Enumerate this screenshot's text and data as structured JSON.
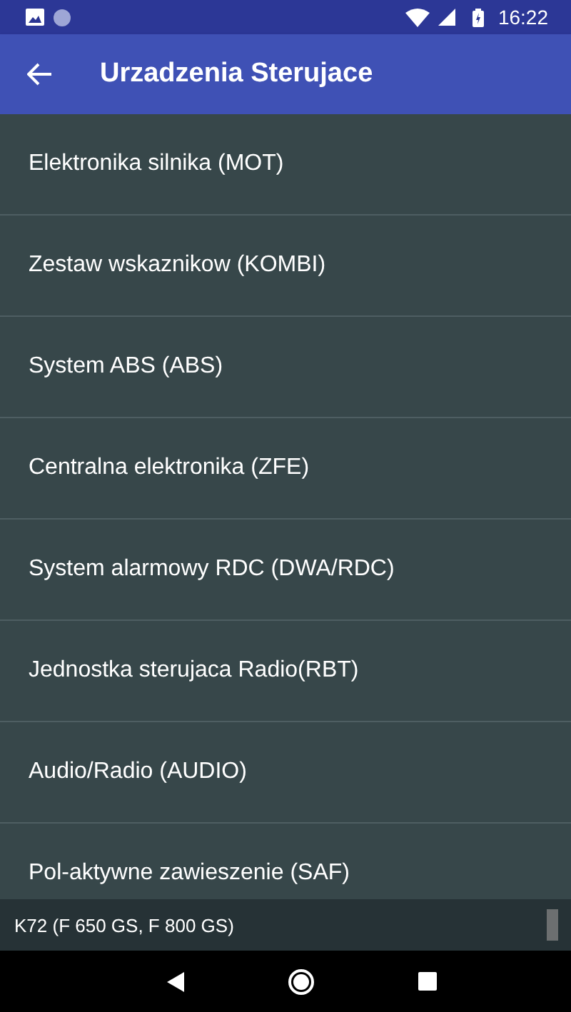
{
  "status_bar": {
    "time": "16:22"
  },
  "app_bar": {
    "title": "Urzadzenia Sterujace"
  },
  "items": [
    {
      "label": "Elektronika silnika (MOT)"
    },
    {
      "label": "Zestaw wskaznikow (KOMBI)"
    },
    {
      "label": "System ABS (ABS)"
    },
    {
      "label": "Centralna elektronika (ZFE)"
    },
    {
      "label": "System alarmowy RDC (DWA/RDC)"
    },
    {
      "label": "Jednostka sterujaca Radio(RBT)"
    },
    {
      "label": "Audio/Radio (AUDIO)"
    },
    {
      "label": "Pol-aktywne zawieszenie (SAF)"
    }
  ],
  "footer": {
    "text": "K72 (F 650 GS, F 800 GS)"
  }
}
